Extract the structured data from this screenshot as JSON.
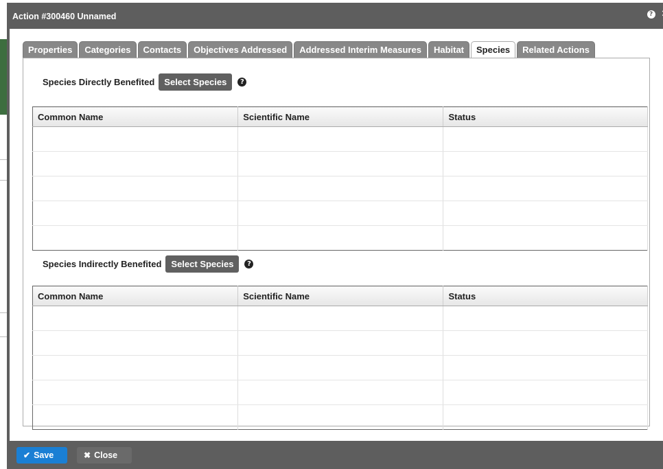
{
  "dialog": {
    "title": "Action #300460 Unnamed",
    "help_glyph": "?",
    "close_glyph": "✕"
  },
  "tabs": [
    {
      "label": "Properties",
      "active": false
    },
    {
      "label": "Categories",
      "active": false
    },
    {
      "label": "Contacts",
      "active": false
    },
    {
      "label": "Objectives Addressed",
      "active": false
    },
    {
      "label": "Addressed Interim Measures",
      "active": false
    },
    {
      "label": "Habitat",
      "active": false
    },
    {
      "label": "Species",
      "active": true
    },
    {
      "label": "Related Actions",
      "active": false
    }
  ],
  "direct": {
    "label": "Species Directly Benefited",
    "button": "Select Species",
    "columns": [
      "Common Name",
      "Scientific Name",
      "Status"
    ],
    "rows": [
      [
        "",
        "",
        ""
      ],
      [
        "",
        "",
        ""
      ],
      [
        "",
        "",
        ""
      ],
      [
        "",
        "",
        ""
      ],
      [
        "",
        "",
        ""
      ]
    ]
  },
  "indirect": {
    "label": "Species Indirectly Benefited",
    "button": "Select Species",
    "columns": [
      "Common Name",
      "Scientific Name",
      "Status"
    ],
    "rows": [
      [
        "",
        "",
        ""
      ],
      [
        "",
        "",
        ""
      ],
      [
        "",
        "",
        ""
      ],
      [
        "",
        "",
        ""
      ],
      [
        "",
        "",
        ""
      ]
    ]
  },
  "footer": {
    "save_label": "Save",
    "close_label": "Close"
  },
  "colors": {
    "titlebar": "#5e5e5e",
    "save_button": "#1a7fd4",
    "tab_inactive": "#888888",
    "background_sidebar": "#3d6e3f"
  }
}
